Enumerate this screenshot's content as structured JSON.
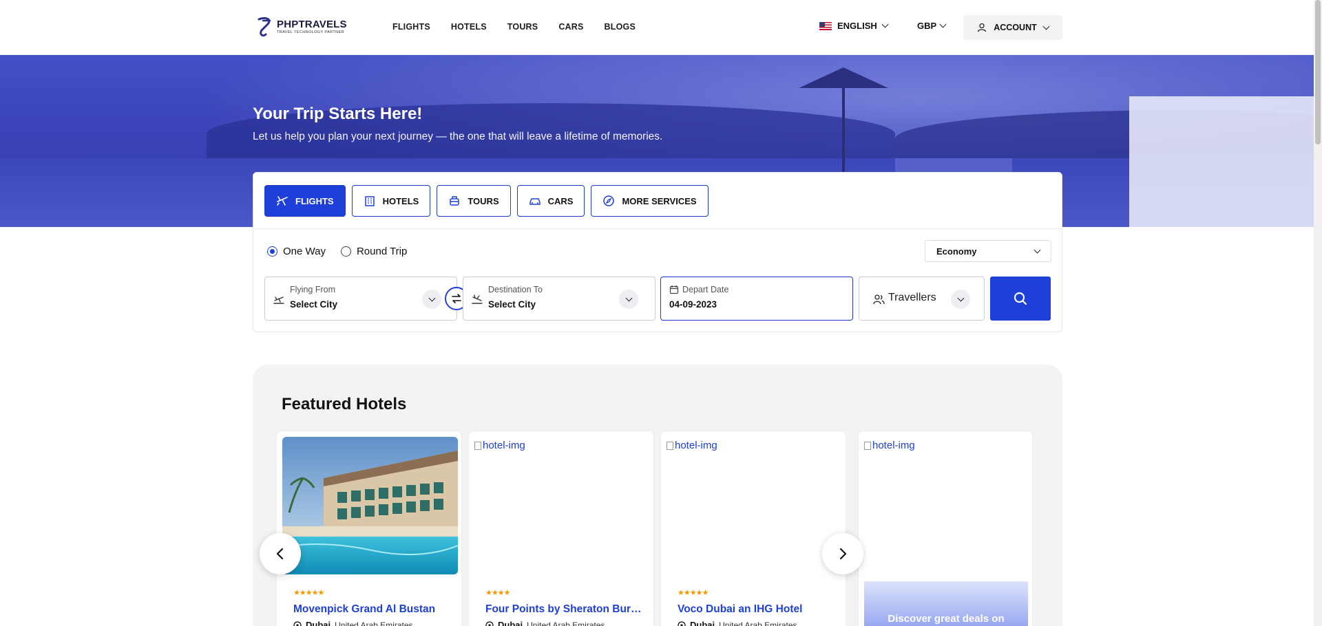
{
  "header": {
    "logo_title": "PHPTRAVELS",
    "logo_subtitle": "TRAVEL TECHNOLOGY PARTNER",
    "nav": [
      "FLIGHTS",
      "HOTELS",
      "TOURS",
      "CARS",
      "BLOGS"
    ],
    "language": "ENGLISH",
    "currency": "GBP",
    "account": "ACCOUNT"
  },
  "hero": {
    "title": "Your Trip Starts Here!",
    "subtitle": "Let us help you plan your next journey — the one that will leave a lifetime of memories."
  },
  "search": {
    "tabs": [
      "FLIGHTS",
      "HOTELS",
      "TOURS",
      "CARS",
      "MORE SERVICES"
    ],
    "active_tab": "FLIGHTS",
    "trip_types": [
      "One Way",
      "Round Trip"
    ],
    "selected_trip_type": "One Way",
    "cabin_class": "Economy",
    "flying_from": {
      "label": "Flying From",
      "value": "Select City"
    },
    "destination": {
      "label": "Destination To",
      "value": "Select City"
    },
    "depart_date": {
      "label": "Depart Date",
      "value": "04-09-2023"
    },
    "travellers": "Travellers"
  },
  "featured": {
    "title": "Featured Hotels",
    "hotels": [
      {
        "name": "Movenpick Grand Al Bustan",
        "city": "Dubai",
        "country": "United Arab Emirates",
        "stars": 5,
        "image": "photo"
      },
      {
        "name": "Four Points by Sheraton Bur Dubai",
        "city": "Dubai",
        "country": "United Arab Emirates",
        "stars": 4,
        "image_alt": "hotel-img"
      },
      {
        "name": "Voco Dubai an IHG Hotel",
        "city": "Dubai",
        "country": "United Arab Emirates",
        "stars": 5,
        "image_alt": "hotel-img"
      },
      {
        "image_alt": "hotel-img",
        "promo": "Discover great deals on"
      }
    ]
  },
  "colors": {
    "brand": "#1e40d8",
    "star": "#f59a00",
    "hero": "#3a44b8"
  }
}
